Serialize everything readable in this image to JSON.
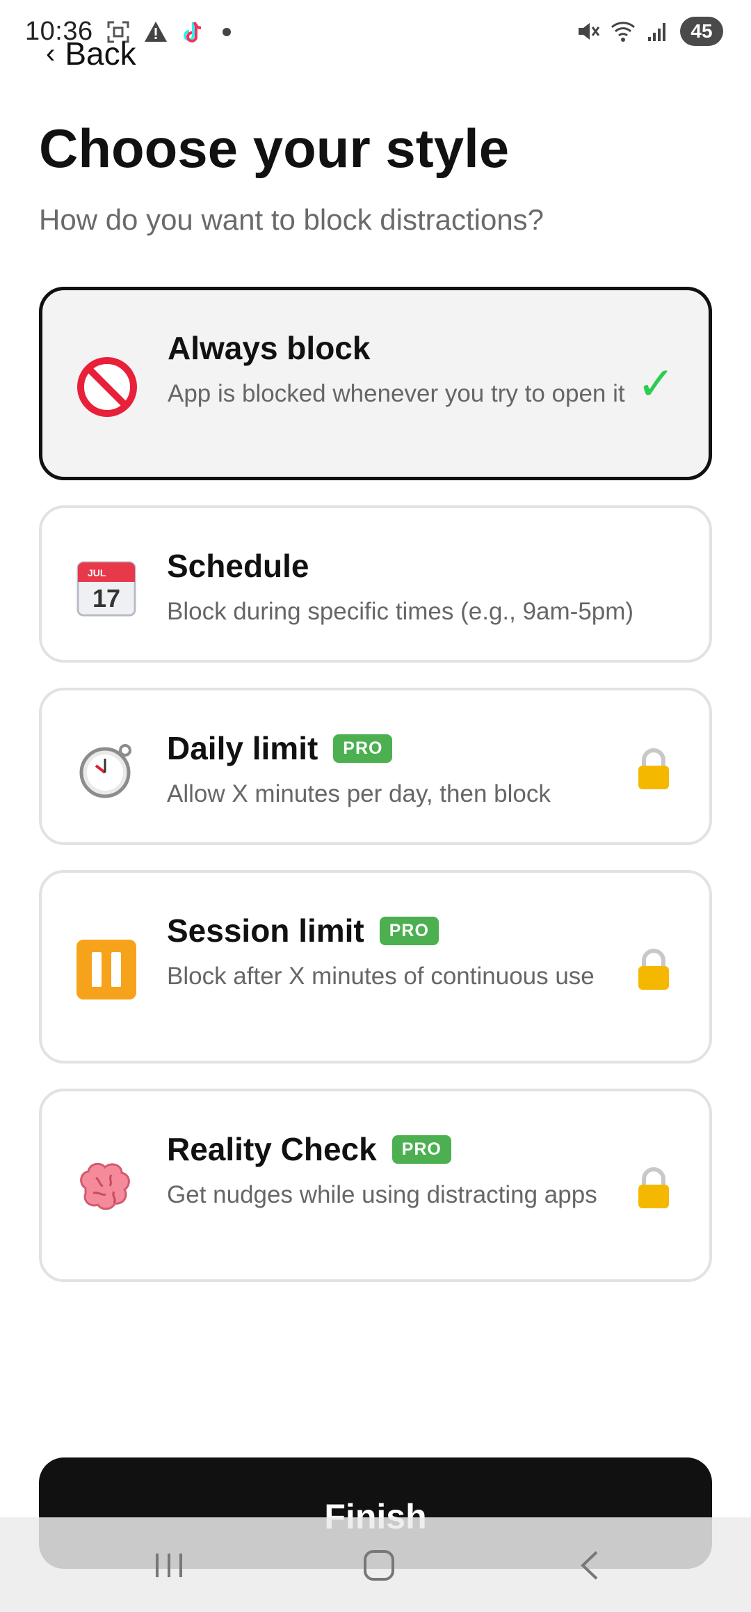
{
  "status_bar": {
    "time": "10:36",
    "battery": "45",
    "icons": [
      "screenshot-icon",
      "warning-icon",
      "tiktok-icon",
      "notification-dot",
      "mute-icon",
      "wifi-icon",
      "signal-icon",
      "battery-icon"
    ]
  },
  "header": {
    "back_label": "Back",
    "title": "Choose your style",
    "subtitle": "How do you want to block distractions?"
  },
  "options": [
    {
      "icon": "prohibited-icon",
      "title": "Always block",
      "desc": "App is blocked whenever you try to open it",
      "selected": true,
      "pro": false
    },
    {
      "icon": "calendar-icon",
      "title": "Schedule",
      "desc": "Block during specific times (e.g., 9am-5pm)",
      "selected": false,
      "pro": false,
      "calendar_month": "JUL",
      "calendar_day": "17"
    },
    {
      "icon": "stopwatch-icon",
      "title": "Daily limit",
      "desc": "Allow X minutes per day, then block",
      "selected": false,
      "pro": true,
      "pro_label": "PRO"
    },
    {
      "icon": "pause-icon",
      "title": "Session limit",
      "desc": "Block after X minutes of continuous use",
      "selected": false,
      "pro": true,
      "pro_label": "PRO"
    },
    {
      "icon": "brain-icon",
      "title": "Reality Check",
      "desc": "Get nudges while using distracting apps",
      "selected": false,
      "pro": true,
      "pro_label": "PRO"
    }
  ],
  "finish_label": "Finish",
  "colors": {
    "accent_green": "#4CAF50",
    "check_green": "#2ecc52",
    "button_black": "#111111"
  }
}
